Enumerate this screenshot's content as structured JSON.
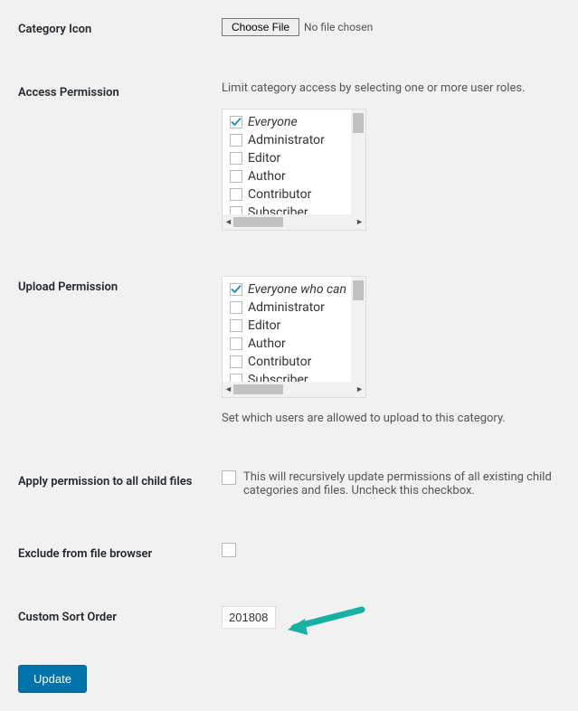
{
  "categoryIcon": {
    "label": "Category Icon",
    "buttonLabel": "Choose File",
    "status": "No file chosen"
  },
  "accessPermission": {
    "label": "Access Permission",
    "description": "Limit category access by selecting one or more user roles.",
    "roles": [
      {
        "label": "Everyone",
        "checked": true,
        "italic": true
      },
      {
        "label": "Administrator",
        "checked": false,
        "italic": false
      },
      {
        "label": "Editor",
        "checked": false,
        "italic": false
      },
      {
        "label": "Author",
        "checked": false,
        "italic": false
      },
      {
        "label": "Contributor",
        "checked": false,
        "italic": false
      },
      {
        "label": "Subscriber",
        "checked": false,
        "italic": false
      }
    ]
  },
  "uploadPermission": {
    "label": "Upload Permission",
    "description": "Set which users are allowed to upload to this category.",
    "roles": [
      {
        "label": "Everyone who can",
        "checked": true,
        "italic": true
      },
      {
        "label": "Administrator",
        "checked": false,
        "italic": false
      },
      {
        "label": "Editor",
        "checked": false,
        "italic": false
      },
      {
        "label": "Author",
        "checked": false,
        "italic": false
      },
      {
        "label": "Contributor",
        "checked": false,
        "italic": false
      },
      {
        "label": "Subscriber",
        "checked": false,
        "italic": false
      }
    ]
  },
  "applyPermission": {
    "label": "Apply permission to all child files",
    "text": "This will recursively update permissions of all existing child categories and files. Uncheck this checkbox."
  },
  "excludeBrowser": {
    "label": "Exclude from file browser"
  },
  "customSort": {
    "label": "Custom Sort Order",
    "value": "201808"
  },
  "updateButton": {
    "label": "Update"
  },
  "scrollArrows": {
    "left": "◄",
    "right": "►"
  }
}
